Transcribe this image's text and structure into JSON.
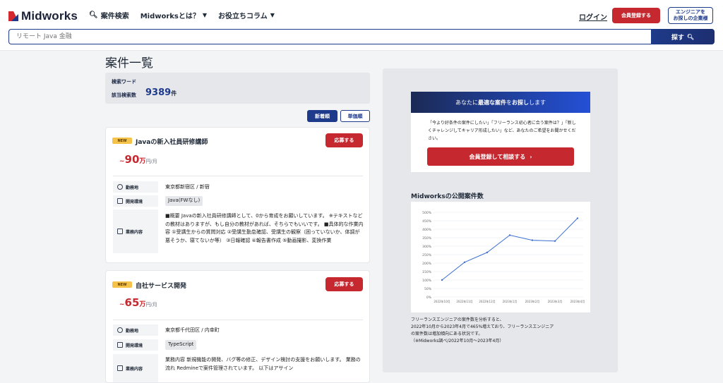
{
  "header": {
    "logo_text": "Midworks",
    "nav": [
      {
        "label": "案件検索",
        "icon": "search-icon"
      },
      {
        "label": "Midworksとは？",
        "icon": "caret-down-icon"
      },
      {
        "label": "お役立ちコラム",
        "icon": "caret-down-icon"
      }
    ],
    "login": "ログイン",
    "register": "会員登録する",
    "company_line1": "エンジニアを",
    "company_line2": "お探しの企業様"
  },
  "search": {
    "placeholder": "リモート Java 金融",
    "button": "探す"
  },
  "main": {
    "title": "案件一覧",
    "keyword_label": "検索ワード",
    "count_label": "該当検索数",
    "count": "9389",
    "count_unit": "件",
    "sort_new": "新着順",
    "sort_price": "単価順",
    "jobs": [
      {
        "badge": "NEW",
        "title": "Javaの新入社員研修講師",
        "apply": "応募する",
        "price_tilde": "~",
        "price": "90",
        "price_man": "万",
        "price_unit": "円/月",
        "location_label": "勤務地",
        "location": "東京都新宿区 / 新宿",
        "env_label": "開発環境",
        "env": "Java(FWなし)",
        "desc_label": "業務内容",
        "desc": "■概要 Javaの新入社員研修講師として、0から育成をお願いしています。 ※テキストなどの教材はありますが、もし自分の教材があれば、そちらでもいいです。 ■具体的な作業内容 ①受講生からの質問対応 ②受講生勤怠確認、受講生の観察（困っていないか、体調が悪そうか、寝てないか等） ③日報確認 ④報告書作成 ⑤動画撮影、変換作業"
      },
      {
        "badge": "NEW",
        "title": "自社サービス開発",
        "apply": "応募する",
        "price_tilde": "~",
        "price": "65",
        "price_man": "万",
        "price_unit": "円/月",
        "location_label": "勤務地",
        "location": "東京都千代田区 / 内幸町",
        "env_label": "開発環境",
        "env": "TypeScript",
        "desc_label": "業務内容",
        "desc": "業務内容 新規機能の開発、バグ等の修正、デザイン検討の支援をお願いします。 業務の流れ Redmineで案件管理されています。 以下はアサイン"
      }
    ]
  },
  "promo": {
    "head_pre": "あなたに",
    "head_bold": "最適な案件",
    "head_mid": "を",
    "head_bold2": "お探し",
    "head_post": "します",
    "text": "「今より好条件の案件にしたい」「フリーランス初心者に合う案件は？」「新しくチャレンジしてキャリア形成したい」など、あなたのご希望をお聞かせください。",
    "button": "会員登録して相談する",
    "button_icon": "chevron-right-icon"
  },
  "chart_section": {
    "title": "Midworksの公開案件数",
    "note_line1": "フリーランスエンジニアの案件数を分析すると、",
    "note_line2": "2022年10月から2023年4月で465%増えており、フリーランスエンジニア",
    "note_line3": "の案件数は増加傾向にある状況です。",
    "note_line4": "（※Midworks調べ/2022年10月～2023年4月）"
  },
  "chart_data": {
    "type": "line",
    "categories": [
      "2022年10月",
      "2022年11月",
      "2022年12月",
      "2023年1月",
      "2023年2月",
      "2023年3月",
      "2023年4月"
    ],
    "series": [
      {
        "values": [
          100,
          205,
          263,
          365,
          335,
          330,
          465
        ]
      }
    ],
    "yticks": [
      "500%",
      "450%",
      "400%",
      "350%",
      "300%",
      "250%",
      "200%",
      "150%",
      "100%",
      "50%",
      "0%"
    ],
    "ylim": [
      0,
      500
    ],
    "title": "",
    "xlabel": "",
    "ylabel": "",
    "grid": true,
    "color": "#3b6fd4"
  }
}
